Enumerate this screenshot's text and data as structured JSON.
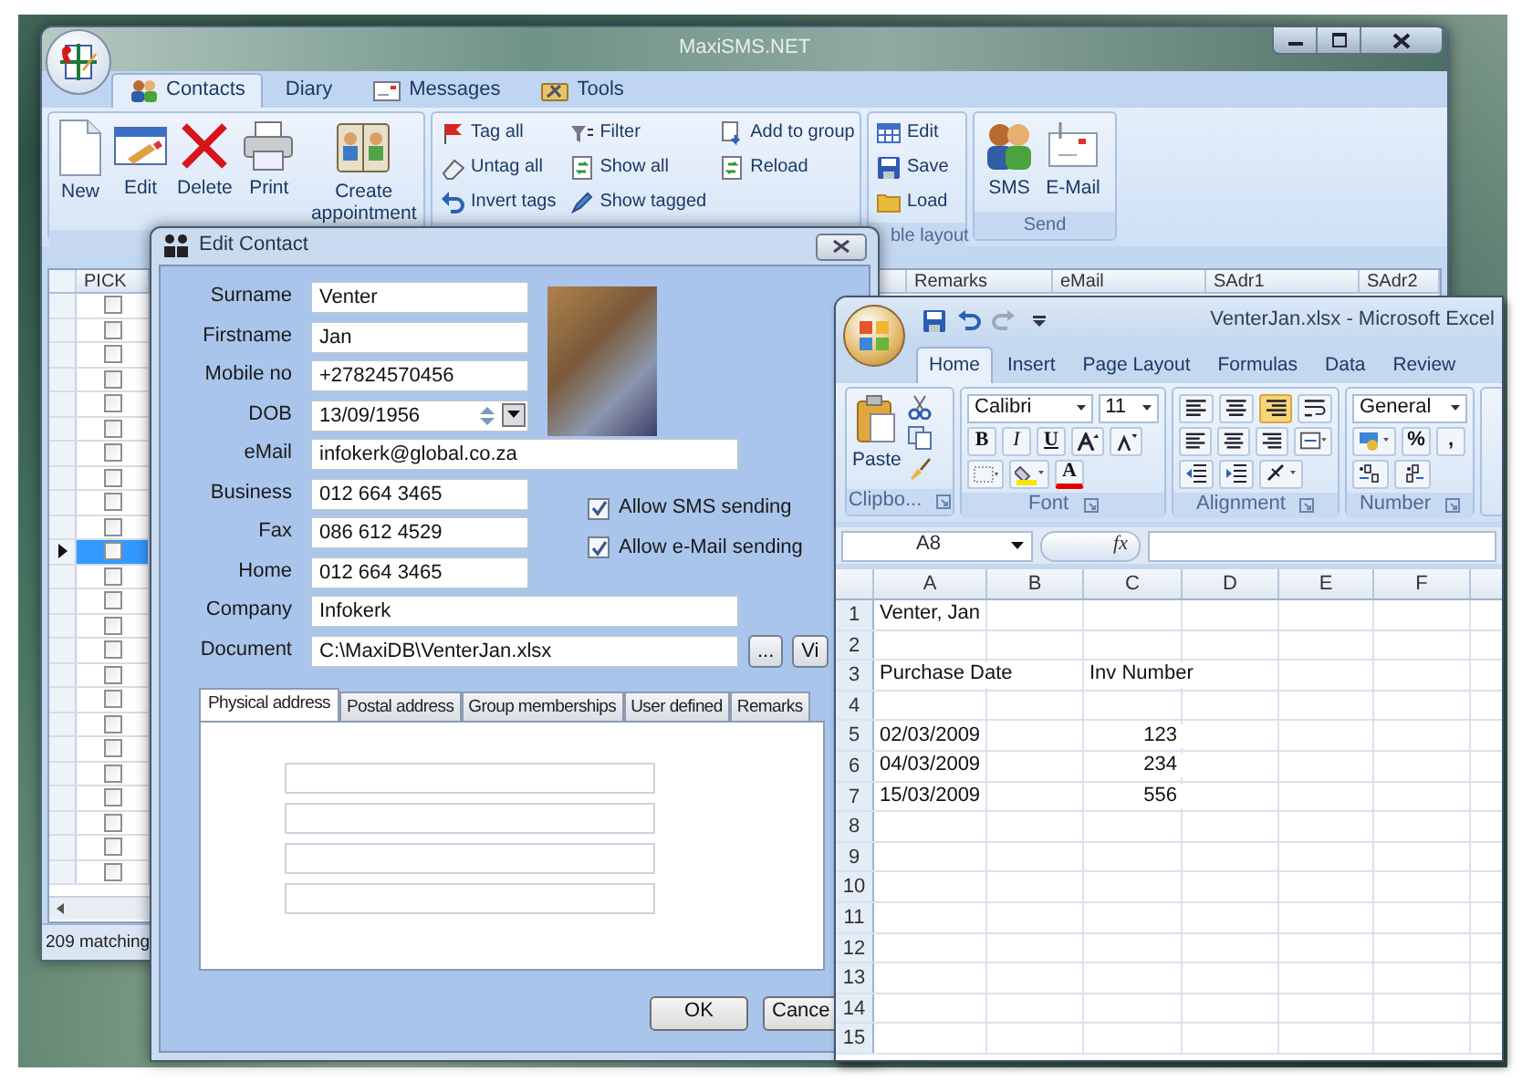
{
  "main_window": {
    "title": "MaxiSMS.NET",
    "tabs": [
      {
        "label": "Contacts",
        "selected": true
      },
      {
        "label": "Diary",
        "selected": false
      },
      {
        "label": "Messages",
        "selected": false
      },
      {
        "label": "Tools",
        "selected": false
      }
    ],
    "ribbon_groups": [
      {
        "buttons": [
          {
            "label": "New",
            "kind": "large"
          },
          {
            "label": "Edit",
            "kind": "large"
          },
          {
            "label": "Delete",
            "kind": "large"
          },
          {
            "label": "Print",
            "kind": "large"
          },
          {
            "label": "Create appointment",
            "kind": "large"
          }
        ]
      },
      {
        "buttons": [
          {
            "label": "Tag all",
            "kind": "small"
          },
          {
            "label": "Untag all",
            "kind": "small"
          },
          {
            "label": "Invert tags",
            "kind": "small"
          },
          {
            "label": "Filter",
            "kind": "small"
          },
          {
            "label": "Show all",
            "kind": "small"
          },
          {
            "label": "Show tagged",
            "kind": "small"
          },
          {
            "label": "Add to group",
            "kind": "small"
          },
          {
            "label": "Reload",
            "kind": "small"
          }
        ]
      },
      {
        "label": "ble layout",
        "buttons": [
          {
            "label": "Edit",
            "kind": "small"
          },
          {
            "label": "Save",
            "kind": "small"
          },
          {
            "label": "Load",
            "kind": "small"
          }
        ]
      },
      {
        "label": "Send",
        "buttons": [
          {
            "label": "SMS",
            "kind": "large"
          },
          {
            "label": "E-Mail",
            "kind": "large"
          }
        ]
      }
    ],
    "grid": {
      "columns": [
        "PICK",
        "Remarks",
        "eMail",
        "SAdr1",
        "SAdr2"
      ],
      "rows": [
        {
          "checked": false,
          "selected": false
        },
        {
          "checked": false,
          "selected": false
        },
        {
          "checked": false,
          "selected": false
        },
        {
          "checked": false,
          "selected": false
        },
        {
          "checked": false,
          "selected": false
        },
        {
          "checked": false,
          "selected": false
        },
        {
          "checked": false,
          "selected": false
        },
        {
          "checked": false,
          "selected": false
        },
        {
          "checked": false,
          "selected": false
        },
        {
          "checked": false,
          "selected": false
        },
        {
          "checked": false,
          "selected": true
        },
        {
          "checked": false,
          "selected": false
        },
        {
          "checked": false,
          "selected": false
        },
        {
          "checked": false,
          "selected": false
        },
        {
          "checked": false,
          "selected": false
        },
        {
          "checked": false,
          "selected": false
        },
        {
          "checked": false,
          "selected": false
        },
        {
          "checked": false,
          "selected": false
        },
        {
          "checked": false,
          "selected": false
        },
        {
          "checked": false,
          "selected": false
        },
        {
          "checked": false,
          "selected": false
        },
        {
          "checked": false,
          "selected": false
        },
        {
          "checked": false,
          "selected": false
        },
        {
          "checked": false,
          "selected": false
        }
      ]
    },
    "status": "209 matching"
  },
  "edit_contact": {
    "title": "Edit Contact",
    "fields": [
      {
        "label": "Surname",
        "value": "Venter",
        "kind": "short"
      },
      {
        "label": "Firstname",
        "value": "Jan",
        "kind": "short"
      },
      {
        "label": "Mobile no",
        "value": "+27824570456",
        "kind": "short"
      },
      {
        "label": "DOB",
        "value": "13/09/1956",
        "kind": "date"
      },
      {
        "label": "eMail",
        "value": "infokerk@global.co.za",
        "kind": "wide"
      },
      {
        "label": "Business",
        "value": "012 664 3465",
        "kind": "short"
      },
      {
        "label": "Fax",
        "value": "086 612 4529",
        "kind": "short"
      },
      {
        "label": "Home",
        "value": "012 664 3465",
        "kind": "short"
      },
      {
        "label": "Company",
        "value": "Infokerk",
        "kind": "wide"
      }
    ],
    "options": [
      {
        "label": "Allow SMS sending",
        "checked": true
      },
      {
        "label": "Allow e-Mail sending",
        "checked": true
      }
    ],
    "document": {
      "label": "Document",
      "value": "C:\\MaxiDB\\VenterJan.xlsx",
      "browse": "...",
      "view": "Vi"
    },
    "tabs": [
      {
        "label": "Physical address",
        "selected": true
      },
      {
        "label": "Postal address",
        "selected": false
      },
      {
        "label": "Group memberships",
        "selected": false
      },
      {
        "label": "User defined",
        "selected": false
      },
      {
        "label": "Remarks",
        "selected": false
      }
    ],
    "buttons": [
      "OK",
      "Cance"
    ]
  },
  "excel": {
    "title": "VenterJan.xlsx - Microsoft Excel",
    "tabs": [
      {
        "label": "Home",
        "selected": true
      },
      {
        "label": "Insert",
        "selected": false
      },
      {
        "label": "Page Layout",
        "selected": false
      },
      {
        "label": "Formulas",
        "selected": false
      },
      {
        "label": "Data",
        "selected": false
      },
      {
        "label": "Review",
        "selected": false
      }
    ],
    "clipboard": {
      "paste": "Paste",
      "group": "Clipbo..."
    },
    "font": {
      "name": "Calibri",
      "size": "11",
      "styles": [
        "B",
        "I",
        "U"
      ],
      "color_letter": "A",
      "group": "Font"
    },
    "alignment": {
      "group": "Alignment"
    },
    "number": {
      "format": "General",
      "symbols": [
        "%",
        ","
      ],
      "group": "Number"
    },
    "name_box": "A8",
    "fx": "fx",
    "columns": [
      "A",
      "B",
      "C",
      "D",
      "E",
      "F"
    ],
    "rows": [
      {
        "label": "1",
        "cells": [
          {
            "text": "Venter, Jan",
            "kind": "text"
          }
        ]
      },
      {
        "label": "2"
      },
      {
        "label": "3",
        "cells": [
          {
            "text": "Purchase Date",
            "kind": "text"
          },
          null,
          {
            "text": "Inv Number",
            "kind": "text"
          }
        ]
      },
      {
        "label": "4"
      },
      {
        "label": "5",
        "cells": [
          {
            "text": "02/03/2009",
            "kind": "text"
          },
          null,
          {
            "text": "123",
            "kind": "number"
          }
        ]
      },
      {
        "label": "6",
        "cells": [
          {
            "text": "04/03/2009",
            "kind": "text"
          },
          null,
          {
            "text": "234",
            "kind": "number"
          }
        ]
      },
      {
        "label": "7",
        "cells": [
          {
            "text": "15/03/2009",
            "kind": "text"
          },
          null,
          {
            "text": "556",
            "kind": "number"
          }
        ]
      },
      {
        "label": "8"
      },
      {
        "label": "9"
      },
      {
        "label": "10"
      },
      {
        "label": "11"
      },
      {
        "label": "12"
      },
      {
        "label": "13"
      },
      {
        "label": "14"
      },
      {
        "label": "15"
      }
    ]
  }
}
